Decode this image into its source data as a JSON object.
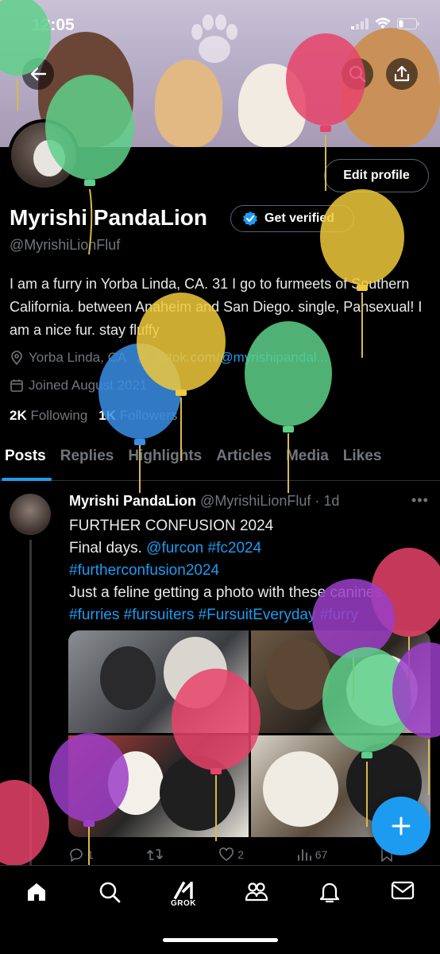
{
  "status_bar": {
    "time": "12:05"
  },
  "colors": {
    "accent": "#1d9bf0",
    "background": "#000000",
    "muted": "#71767b"
  },
  "profile": {
    "edit_button": "Edit profile",
    "display_name": "Myrishi PandaLion",
    "get_verified": "Get verified",
    "handle": "@MyrishiLionFluf",
    "bio": "I am a furry in Yorba Linda, CA. 31 I go to furmeets of Southern California. between Anaheim and San Diego. single, Pansexual! I am a nice fur. stay fluffy",
    "location": "Yorba Linda, CA",
    "link": "tiktok.com/@myrishipandal...",
    "joined": "Joined August 2021",
    "following_count": "2K",
    "following_label": "Following",
    "followers_count": "1K",
    "followers_label": "Followers"
  },
  "tabs": [
    "Posts",
    "Replies",
    "Highlights",
    "Articles",
    "Media",
    "Likes"
  ],
  "post": {
    "author": "Myrishi PandaLion",
    "handle": "@MyrishiLionFluf",
    "time": "· 1d",
    "line1": "FURTHER CONFUSION 2024",
    "line2_text": "Final days.",
    "line2_tags": "@furcon #fc2024",
    "line3_tags": "#furtherconfusion2024",
    "line4": "Just a feline getting a photo with these canines.",
    "line5_tags": "#furries #fursuiters #FursuitEveryday #furry",
    "replies": "1",
    "reposts": "",
    "likes": "2",
    "views": "67"
  },
  "nav": {
    "grok_label": "GROK"
  },
  "icons": [
    "back-arrow-icon",
    "search-icon",
    "share-icon",
    "verified-badge-icon",
    "location-pin-icon",
    "calendar-icon",
    "more-icon",
    "reply-icon",
    "repost-icon",
    "like-icon",
    "views-icon",
    "bookmark-icon",
    "compose-plus-icon",
    "home-icon",
    "explore-icon",
    "grok-icon",
    "communities-icon",
    "notifications-icon",
    "messages-icon"
  ]
}
